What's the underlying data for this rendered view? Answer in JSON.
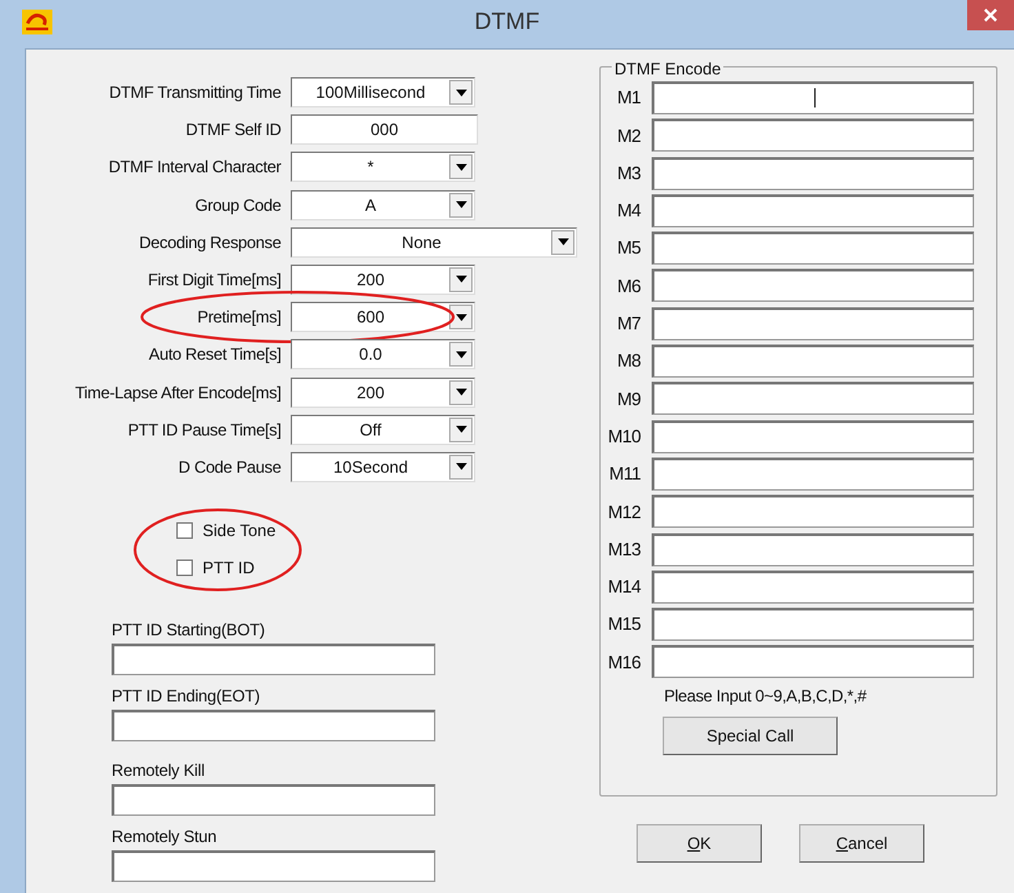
{
  "window": {
    "title": "DTMF"
  },
  "settings": [
    {
      "label": "DTMF Transmitting Time",
      "kind": "combo",
      "value": "100Millisecond",
      "circled": false
    },
    {
      "label": "DTMF Self ID",
      "kind": "text",
      "value": "000",
      "circled": false
    },
    {
      "label": "DTMF Interval Character",
      "kind": "combo",
      "value": "*",
      "circled": false
    },
    {
      "label": "Group Code",
      "kind": "combo",
      "value": "A",
      "circled": false
    },
    {
      "label": "Decoding Response",
      "kind": "combo-wide",
      "value": "None",
      "circled": false
    },
    {
      "label": "First Digit Time[ms]",
      "kind": "combo",
      "value": "200",
      "circled": false
    },
    {
      "label": "Pretime[ms]",
      "kind": "combo",
      "value": "600",
      "circled": true
    },
    {
      "label": "Auto Reset Time[s]",
      "kind": "combo",
      "value": "0.0",
      "circled": false
    },
    {
      "label": "Time-Lapse After Encode[ms]",
      "kind": "combo",
      "value": "200",
      "circled": false
    },
    {
      "label": "PTT ID Pause Time[s]",
      "kind": "combo",
      "value": "Off",
      "circled": false
    },
    {
      "label": "D Code Pause",
      "kind": "combo",
      "value": "10Second",
      "circled": false
    }
  ],
  "options": {
    "circled": true,
    "items": [
      {
        "label": "Side Tone",
        "checked": false
      },
      {
        "label": "PTT ID",
        "checked": false
      }
    ]
  },
  "code_fields": [
    {
      "label": "PTT ID Starting(BOT)"
    },
    {
      "label": "PTT ID Ending(EOT)"
    },
    {
      "label": "Remotely Kill"
    },
    {
      "label": "Remotely Stun"
    }
  ],
  "encode": {
    "title": "DTMF Encode",
    "rows": [
      {
        "label": "M1",
        "focused": true
      },
      {
        "label": "M2",
        "focused": false
      },
      {
        "label": "M3",
        "focused": false
      },
      {
        "label": "M4",
        "focused": false
      },
      {
        "label": "M5",
        "focused": false
      },
      {
        "label": "M6",
        "focused": false
      },
      {
        "label": "M7",
        "focused": false
      },
      {
        "label": "M8",
        "focused": false
      },
      {
        "label": "M9",
        "focused": false
      },
      {
        "label": "M10",
        "focused": false
      },
      {
        "label": "M11",
        "focused": false
      },
      {
        "label": "M12",
        "focused": false
      },
      {
        "label": "M13",
        "focused": false
      },
      {
        "label": "M14",
        "focused": false
      },
      {
        "label": "M15",
        "focused": false
      },
      {
        "label": "M16",
        "focused": false
      }
    ],
    "hint": "Please Input 0~9,A,B,C,D,*,#",
    "button": "Special Call"
  },
  "buttons": [
    {
      "label": "OK",
      "mnemonic": true
    },
    {
      "label": "Cancel",
      "mnemonic": true
    }
  ]
}
